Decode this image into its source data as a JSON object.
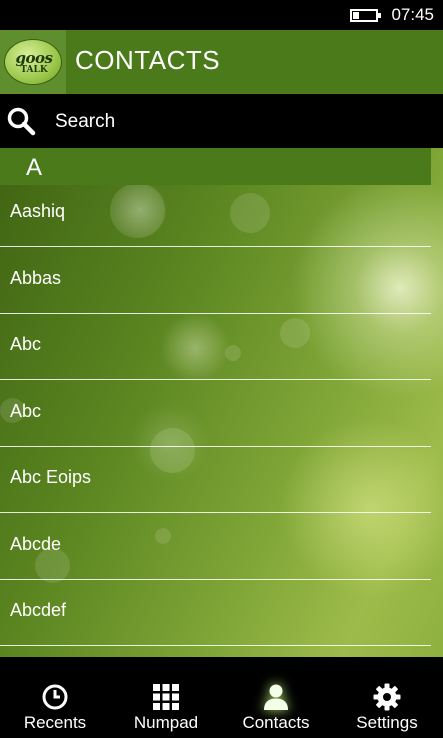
{
  "status": {
    "time": "07:45",
    "battery_level": 0.25
  },
  "header": {
    "title": "CONTACTS",
    "logo_text_top": "goos",
    "logo_text_bottom": "TALK"
  },
  "search": {
    "label": "Search"
  },
  "section": {
    "letter": "A"
  },
  "contacts": [
    "Aashiq",
    "Abbas",
    "Abc",
    "Abc",
    "Abc Eoips",
    "Abcde",
    "Abcdef"
  ],
  "app_bar": {
    "tabs": [
      {
        "label": "Recents",
        "icon": "clock-icon"
      },
      {
        "label": "Numpad",
        "icon": "numpad-icon"
      },
      {
        "label": "Contacts",
        "icon": "contact-icon",
        "active": true
      },
      {
        "label": "Settings",
        "icon": "gear-icon"
      }
    ]
  },
  "colors": {
    "header": "#4a7a19",
    "accent": "#5f8e2e",
    "background": "#000000"
  }
}
